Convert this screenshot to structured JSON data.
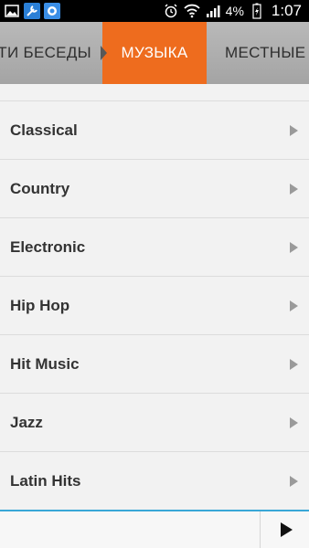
{
  "status_bar": {
    "battery": "4%",
    "time": "1:07"
  },
  "tabs": {
    "left_label": "ОСТИ БЕСЕДЫ",
    "active_label": "МУЗЫКА",
    "right_label": "МЕСТНЫЕ"
  },
  "genres": [
    {
      "label": "Classical"
    },
    {
      "label": "Country"
    },
    {
      "label": "Electronic"
    },
    {
      "label": "Hip Hop"
    },
    {
      "label": "Hit Music"
    },
    {
      "label": "Jazz"
    },
    {
      "label": "Latin Hits"
    }
  ],
  "colors": {
    "accent": "#ee6c1e",
    "player_line": "#39a7d7"
  }
}
